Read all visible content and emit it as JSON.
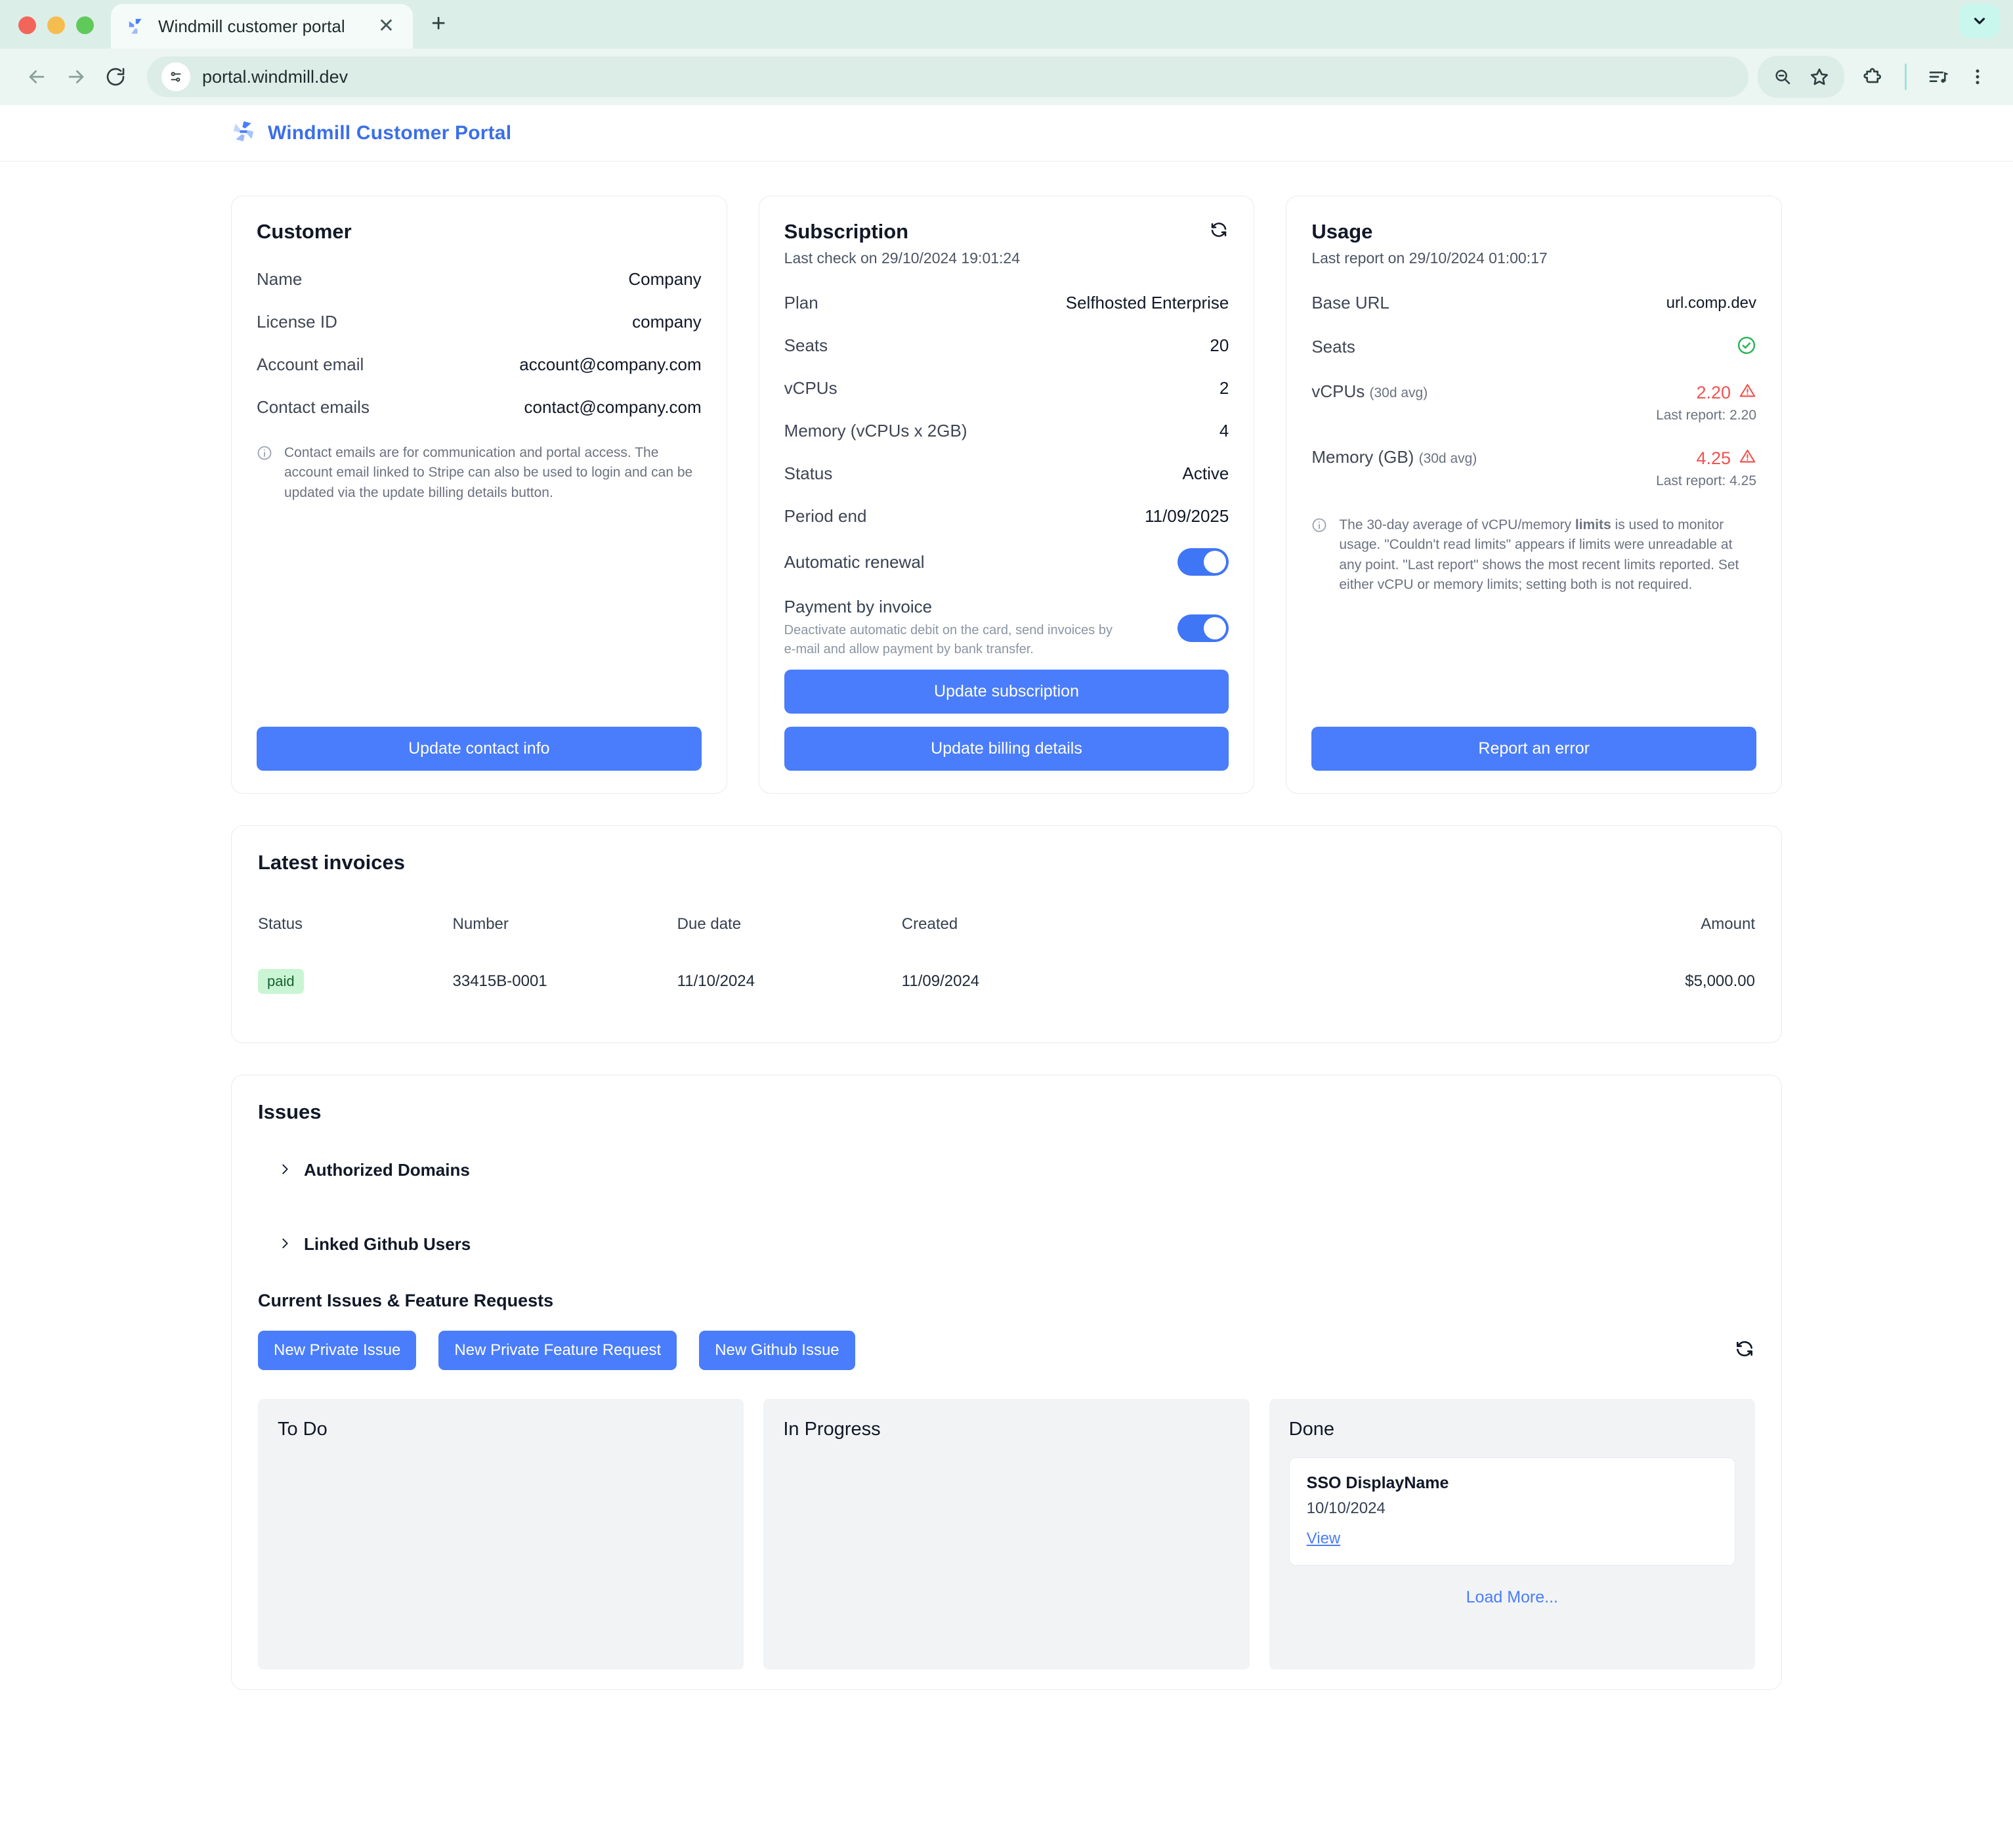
{
  "browser": {
    "tab_title": "Windmill customer portal",
    "tab_favicon": "windmill-logo-icon",
    "close_label": "✕",
    "new_tab_label": "+",
    "back_icon": "back-arrow-icon",
    "forward_icon": "forward-arrow-icon",
    "reload_icon": "reload-icon",
    "url": "portal.windmill.dev",
    "site_info_icon": "site-settings-icon",
    "zoom_out_icon": "zoom-out-icon",
    "bookmark_icon": "star-icon",
    "extensions_icon": "extensions-puzzle-icon",
    "media_icon": "media-list-icon",
    "menu_icon": "kebab-menu-icon",
    "profile_icon": "chevron-down-icon"
  },
  "header": {
    "brand": "Windmill Customer Portal"
  },
  "customer": {
    "title": "Customer",
    "rows": [
      {
        "key": "Name",
        "value": "Company"
      },
      {
        "key": "License ID",
        "value": "company"
      },
      {
        "key": "Account email",
        "value": "account@company.com"
      },
      {
        "key": "Contact emails",
        "value": "contact@company.com"
      }
    ],
    "note": "Contact emails are for communication and portal access. The account email linked to Stripe can also be used to login and can be updated via the update billing details button.",
    "button": "Update contact info"
  },
  "subscription": {
    "title": "Subscription",
    "subtitle": "Last check on 29/10/2024 19:01:24",
    "refresh_icon": "refresh-icon",
    "rows": [
      {
        "key": "Plan",
        "value": "Selfhosted Enterprise"
      },
      {
        "key": "Seats",
        "value": "20"
      },
      {
        "key": "vCPUs",
        "value": "2"
      },
      {
        "key": "Memory (vCPUs x 2GB)",
        "value": "4"
      },
      {
        "key": "Status",
        "value": "Active"
      },
      {
        "key": "Period end",
        "value": "11/09/2025"
      }
    ],
    "auto_renewal_label": "Automatic renewal",
    "auto_renewal_on": true,
    "payment_invoice_label": "Payment by invoice",
    "payment_invoice_desc": "Deactivate automatic debit on the card, send invoices by e-mail and allow payment by bank transfer.",
    "payment_invoice_on": true,
    "button_update_subscription": "Update subscription",
    "button_update_billing": "Update billing details"
  },
  "usage": {
    "title": "Usage",
    "subtitle": "Last report on 29/10/2024 01:00:17",
    "base_url_label": "Base URL",
    "base_url_value": "url.comp.dev",
    "seats_label": "Seats",
    "seats_status_icon": "check-circle-icon",
    "vcpu_label": "vCPUs",
    "vcpu_suffix": "(30d avg)",
    "vcpu_value": "2.20",
    "vcpu_last_report": "Last report: 2.20",
    "memory_label": "Memory (GB)",
    "memory_suffix": "(30d avg)",
    "memory_value": "4.25",
    "memory_last_report": "Last report: 4.25",
    "warning_icon": "warning-triangle-icon",
    "note_part1": "The 30-day average of vCPU/memory ",
    "note_bold": "limits",
    "note_part2": " is used to monitor usage. \"Couldn't read limits\" appears if limits were unreadable at any point. \"Last report\" shows the most recent limits reported. Set either vCPU or memory limits; setting both is not required.",
    "button": "Report an error"
  },
  "invoices": {
    "title": "Latest invoices",
    "columns": [
      "Status",
      "Number",
      "Due date",
      "Created",
      "",
      "Amount"
    ],
    "rows": [
      {
        "status": "paid",
        "number": "33415B-0001",
        "due_date": "11/10/2024",
        "created": "11/09/2024",
        "amount": "$5,000.00"
      }
    ]
  },
  "issues": {
    "title": "Issues",
    "accordions": [
      {
        "label": "Authorized Domains",
        "icon": "chevron-right-icon"
      },
      {
        "label": "Linked Github Users",
        "icon": "chevron-right-icon"
      }
    ],
    "subsection_title": "Current Issues & Feature Requests",
    "buttons": [
      "New Private Issue",
      "New Private Feature Request",
      "New Github Issue"
    ],
    "refresh_icon": "refresh-icon",
    "columns": [
      {
        "title": "To Do",
        "cards": []
      },
      {
        "title": "In Progress",
        "cards": []
      },
      {
        "title": "Done",
        "cards": [
          {
            "title": "SSO DisplayName",
            "date": "10/10/2024",
            "link": "View"
          }
        ],
        "load_more": "Load More..."
      }
    ]
  },
  "colors": {
    "accent": "#4a7dfb",
    "brand": "#3b6fe8",
    "danger": "#ef5350",
    "success": "#22b455",
    "badge_bg": "#c9f5d4",
    "chrome_bg": "#dceee8"
  }
}
